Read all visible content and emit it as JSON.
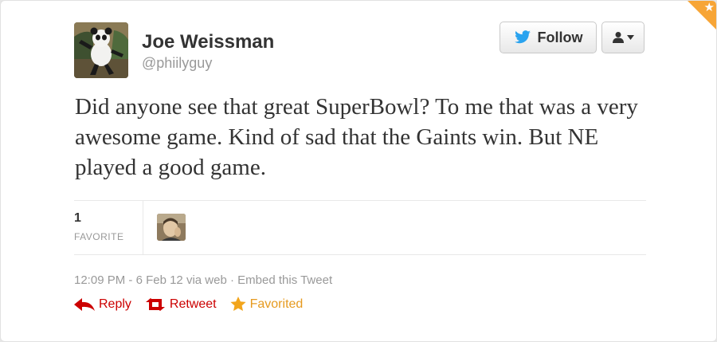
{
  "tweet": {
    "author_name": "Joe Weissman",
    "handle": "@phiilyguy",
    "text": "Did anyone see that great SuperBowl? To me that was a very awesome game. Kind of sad that the Gaints win. But NE played a good game.",
    "favorites_count": "1",
    "favorites_label": "FAVORITE",
    "time": "12:09 PM",
    "date_sep": " - ",
    "date": "6 Feb 12",
    "via": " via web",
    "dot": " · ",
    "embed_label": "Embed this Tweet"
  },
  "buttons": {
    "follow_label": "Follow"
  },
  "actions": {
    "reply_label": "Reply",
    "retweet_label": "Retweet",
    "favorited_label": "Favorited"
  },
  "colors": {
    "action_red": "#cc0000",
    "favorite_orange": "#e69a1f",
    "twitter_blue": "#2aa3ef",
    "corner_badge": "#f7a536"
  },
  "icons": [
    "star-corner-icon",
    "twitter-bird-icon",
    "user-icon",
    "caret-down-icon",
    "reply-arrow-icon",
    "retweet-icon",
    "star-icon"
  ]
}
